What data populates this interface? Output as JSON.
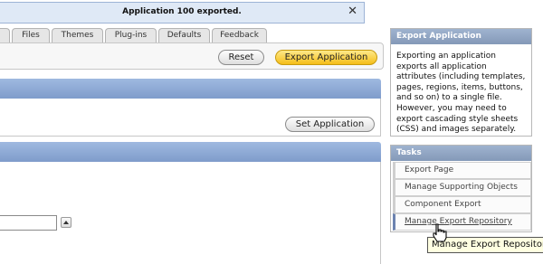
{
  "notification": {
    "message": "Application 100 exported.",
    "close_glyph": "✕"
  },
  "tabs": [
    "",
    "Files",
    "Themes",
    "Plug-ins",
    "Defaults",
    "Feedback"
  ],
  "buttons": {
    "reset": "Reset",
    "export": "Export Application",
    "set_application": "Set Application"
  },
  "export_panel": {
    "title": "Export Application",
    "description": "Exporting an application exports all application attributes (including templates, pages, regions, items, buttons, and so on) to a single file. However, you may need to export cascading style sheets (CSS) and images separately."
  },
  "tasks_panel": {
    "title": "Tasks",
    "items": [
      "Export Page",
      "Manage Supporting Objects",
      "Component Export",
      "Manage Export Repository"
    ]
  },
  "tooltip": "Manage Export Repository",
  "colors": {
    "accent_orange": "#f5be18",
    "region_header": "#8ba6d3",
    "notify_bg": "#dfe9f6"
  }
}
